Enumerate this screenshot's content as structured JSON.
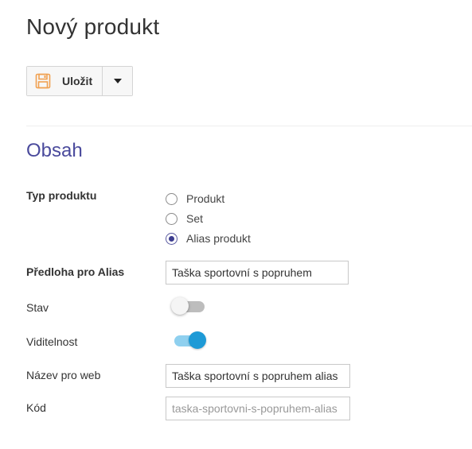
{
  "page": {
    "title": "Nový produkt"
  },
  "toolbar": {
    "save_label": "Uložit",
    "save_icon": "floppy-disk-icon",
    "dropdown_icon": "caret-down-icon"
  },
  "section": {
    "title": "Obsah"
  },
  "form": {
    "product_type": {
      "label": "Typ produktu",
      "options": [
        {
          "label": "Produkt",
          "checked": false
        },
        {
          "label": "Set",
          "checked": false
        },
        {
          "label": "Alias produkt",
          "checked": true
        }
      ]
    },
    "alias_template": {
      "label": "Předloha pro Alias",
      "value": "Taška sportovní s popruhem"
    },
    "status": {
      "label": "Stav",
      "on": false
    },
    "visibility": {
      "label": "Viditelnost",
      "on": true
    },
    "web_name": {
      "label": "Název pro web",
      "value": "Taška sportovní s popruhem alias"
    },
    "code": {
      "label": "Kód",
      "value": "",
      "placeholder": "taska-sportovni-s-popruhem-alias"
    }
  },
  "colors": {
    "section_title": "#4a4a9c",
    "save_icon": "#f0a050",
    "toggle_on": "#1e9ad6",
    "toggle_off": "#bdbdbd"
  }
}
